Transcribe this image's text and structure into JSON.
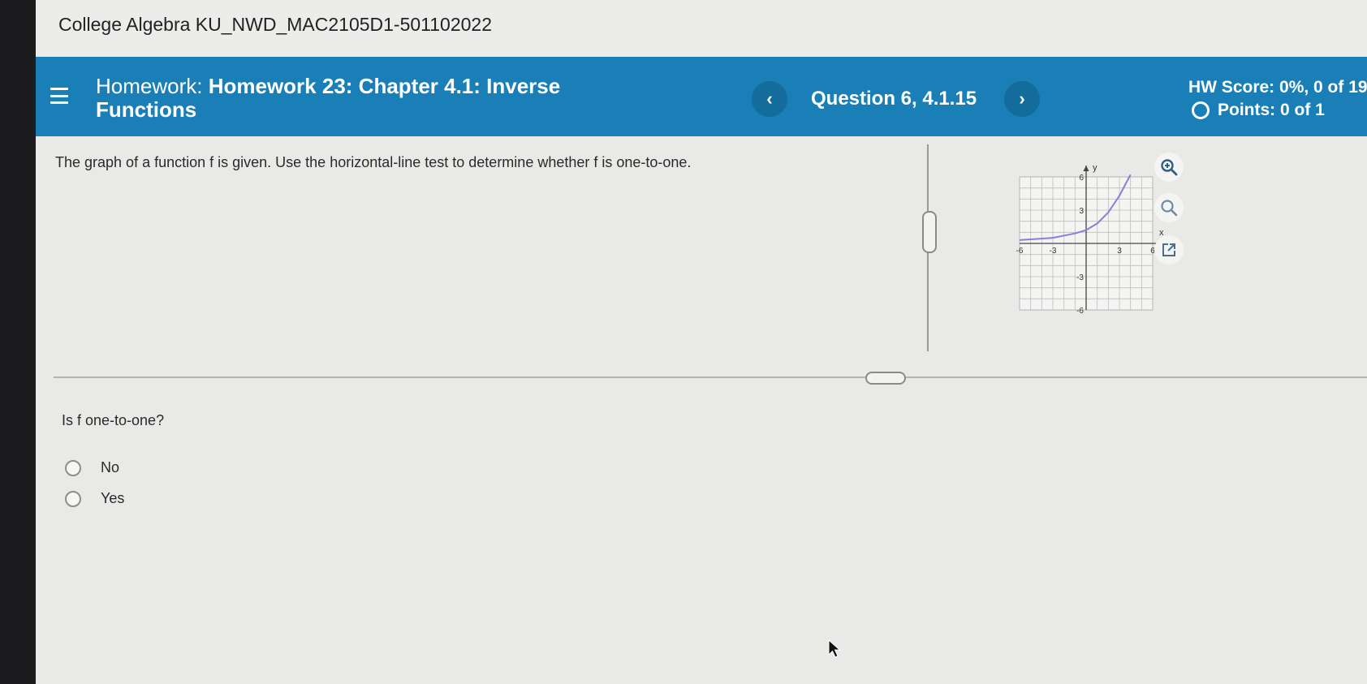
{
  "course": {
    "title": "College Algebra KU_NWD_MAC2105D1-501102022"
  },
  "homework": {
    "prefix": "Homework:",
    "title_line1": "Homework 23: Chapter 4.1: Inverse",
    "title_line2": "Functions",
    "question_label": "Question 6, 4.1.15",
    "prev_glyph": "‹",
    "next_glyph": "›",
    "score": "HW Score: 0%, 0 of 19",
    "points": "Points: 0 of 1"
  },
  "problem": {
    "prompt": "The graph of a function f is given.  Use the horizontal-line test to determine whether f is one-to-one.",
    "question": "Is f one-to-one?",
    "options": [
      {
        "label": "No",
        "selected": false
      },
      {
        "label": "Yes",
        "selected": false
      }
    ]
  },
  "graph": {
    "x_axis_label": "x",
    "y_axis_label": "y",
    "x_ticks": [
      "-6",
      "-3",
      "3",
      "6"
    ],
    "y_ticks": [
      "6",
      "3",
      "-3",
      "-6"
    ],
    "xlim": [
      -6,
      6
    ],
    "ylim": [
      -6,
      6
    ],
    "curve_color": "#8a7fd6",
    "curve_points": [
      [
        -6,
        0.3
      ],
      [
        -3,
        0.5
      ],
      [
        -1,
        0.9
      ],
      [
        0,
        1.2
      ],
      [
        1,
        1.8
      ],
      [
        2,
        2.8
      ],
      [
        3,
        4.3
      ],
      [
        4,
        6.2
      ]
    ]
  },
  "tools": [
    "zoom-in-icon",
    "zoom-out-icon",
    "pop-out-icon"
  ],
  "colors": {
    "header_blue": "#1a7fb6",
    "nav_button": "#146c9c"
  }
}
